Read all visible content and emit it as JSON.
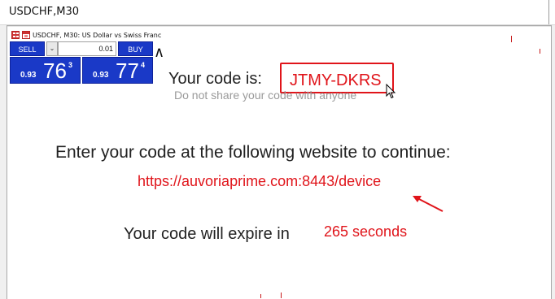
{
  "window": {
    "title": "USDCHF,M30"
  },
  "chart": {
    "header": "USDCHF, M30:  US Dollar vs Swiss Franc"
  },
  "trade_panel": {
    "sell_label": "SELL",
    "buy_label": "BUY",
    "lot_value": "0.01",
    "sell_price": {
      "small": "0.93",
      "big": "76",
      "sup": "3"
    },
    "buy_price": {
      "small": "0.93",
      "big": "77",
      "sup": "4"
    }
  },
  "dialog": {
    "code_label": "Your code is:",
    "code": "JTMY-DKRS",
    "warning": "Do not share your code with anyone",
    "instruction": "Enter your code at the following website to continue:",
    "url": "https://auvoriaprime.com:8443/device",
    "expire_label": "Your code will expire in",
    "expire_value": "265 seconds"
  },
  "colors": {
    "accent_red": "#e0141a",
    "panel_blue": "#1a39c7"
  },
  "icons": [
    "chart-grid-icon",
    "calendar-icon",
    "caret-up-icon",
    "mouse-cursor-icon",
    "arrow-pointer-icon"
  ]
}
